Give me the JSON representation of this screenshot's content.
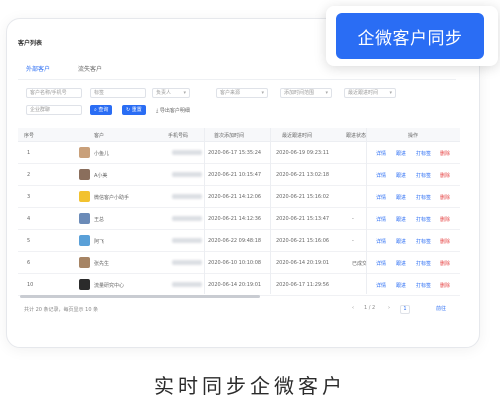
{
  "app": {
    "title": "客户列表"
  },
  "sync_button": {
    "label": "企微客户同步"
  },
  "tabs": [
    {
      "label": "外部客户",
      "active": true
    },
    {
      "label": "流失客户",
      "active": false
    }
  ],
  "filters": {
    "name_placeholder": "客户名称/手机号",
    "tag_placeholder": "标签",
    "owner_select": "负责人",
    "source_select": "客户来源",
    "add_time_select": "添加时间范围",
    "follow_select": "最近跟进时间",
    "group_placeholder": "企业群聊",
    "search_button": "查询",
    "reset_button": "重置",
    "export_text": "导出客户明细"
  },
  "table": {
    "columns": [
      "序号",
      "客户",
      "手机号码",
      "首次添加时间",
      "最近跟进时间",
      "跟进状态",
      "操作"
    ],
    "rows": [
      {
        "index": "1",
        "name": "小鱼儿",
        "added": "2020-06-17 15:35:24",
        "followed": "2020-06-19 09:23:11",
        "status": "",
        "avatar_color": "#c9a07a"
      },
      {
        "index": "2",
        "name": "A小美",
        "added": "2020-06-21 10:15:47",
        "followed": "2020-06-21 13:02:18",
        "status": "",
        "avatar_color": "#8a6e5c"
      },
      {
        "index": "3",
        "name": "微信客户小助手",
        "added": "2020-06-21 14:12:06",
        "followed": "2020-06-21 15:16:02",
        "status": "",
        "avatar_color": "#f2c230"
      },
      {
        "index": "4",
        "name": "王总",
        "added": "2020-06-21 14:12:36",
        "followed": "2020-06-21 15:13:47",
        "status": "-",
        "avatar_color": "#6b8bb8"
      },
      {
        "index": "5",
        "name": "阿飞",
        "added": "2020-06-22 09:48:18",
        "followed": "2020-06-21 15:16:06",
        "status": "-",
        "avatar_color": "#5aa0d8"
      },
      {
        "index": "6",
        "name": "张先生",
        "added": "2020-06-10 10:10:08",
        "followed": "2020-06-14 20:19:01",
        "status": "已成交",
        "avatar_color": "#a68464"
      },
      {
        "index": "10",
        "name": "流量研究中心",
        "added": "2020-06-14 20:19:01",
        "followed": "2020-06-17 11:29:56",
        "status": "",
        "avatar_color": "#2b2b2b"
      }
    ],
    "actions": {
      "detail": "详情",
      "edit": "跟进",
      "transfer": "打标签",
      "delete": "删除"
    }
  },
  "footer": {
    "summary": "共计 20 条记录，每页显示 10 条",
    "page_info": "1 / 2",
    "current_page": "1",
    "goto": "前往"
  },
  "caption": "实时同步企微客户"
}
